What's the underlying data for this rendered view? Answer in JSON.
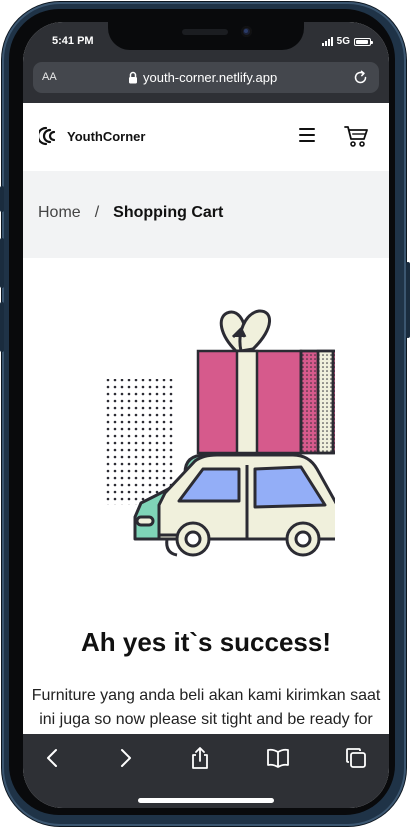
{
  "status_bar": {
    "time": "5:41 PM",
    "network": "5G"
  },
  "browser": {
    "text_size_label": "AA",
    "url": "youth-corner.netlify.app"
  },
  "site": {
    "brand": "YouthCorner",
    "breadcrumb": {
      "home": "Home",
      "separator": "/",
      "current": "Shopping Cart"
    }
  },
  "success": {
    "title": "Ah yes it`s success!",
    "message_line1": "Furniture yang anda beli akan kami kirimkan saat",
    "message_line2": "ini juga so now please sit tight and be ready for"
  },
  "toolbar_icons": [
    "back-icon",
    "forward-icon",
    "share-icon",
    "bookmarks-icon",
    "tabs-icon"
  ],
  "colors": {
    "gift_pink": "#d65a8c",
    "car_cream": "#f0f0dc",
    "car_window_blue": "#93aef7",
    "car_mint": "#7fd4b8",
    "outline": "#2b2b33"
  }
}
